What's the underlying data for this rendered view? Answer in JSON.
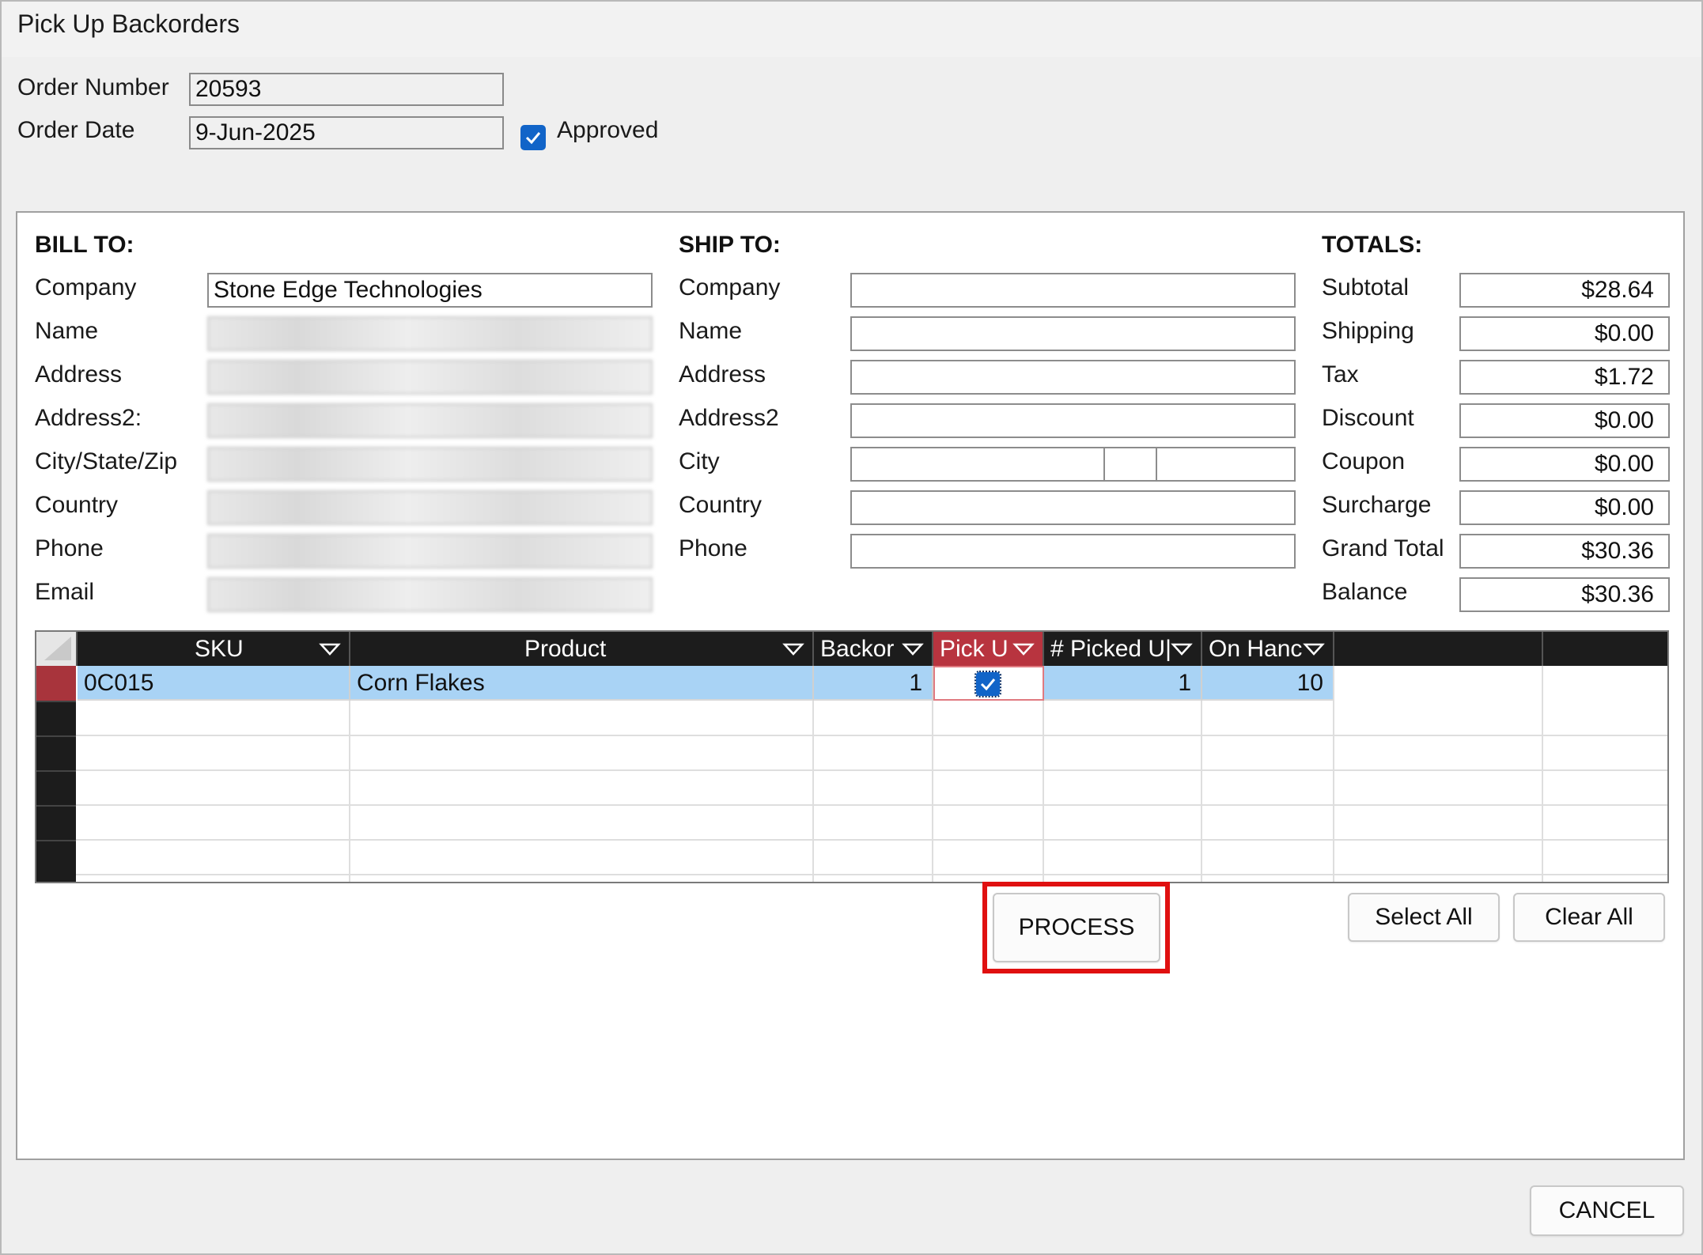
{
  "window": {
    "title": "Pick Up Backorders"
  },
  "order": {
    "number_label": "Order Number",
    "number_value": "20593",
    "date_label": "Order Date",
    "date_value": "9-Jun-2025",
    "approved_label": "Approved",
    "approved_checked": true
  },
  "bill_to": {
    "header": "BILL TO:",
    "company_label": "Company",
    "company_value": "Stone Edge Technologies",
    "name_label": "Name",
    "address_label": "Address",
    "address2_label": "Address2:",
    "city_label": "City/State/Zip",
    "country_label": "Country",
    "phone_label": "Phone",
    "email_label": "Email"
  },
  "ship_to": {
    "header": "SHIP TO:",
    "company_label": "Company",
    "name_label": "Name",
    "address_label": "Address",
    "address2_label": "Address2",
    "city_label": "City",
    "country_label": "Country",
    "phone_label": "Phone"
  },
  "totals": {
    "header": "TOTALS:",
    "subtotal_label": "Subtotal",
    "subtotal": "$28.64",
    "shipping_label": "Shipping",
    "shipping": "$0.00",
    "tax_label": "Tax",
    "tax": "$1.72",
    "discount_label": "Discount",
    "discount": "$0.00",
    "coupon_label": "Coupon",
    "coupon": "$0.00",
    "surcharge_label": "Surcharge",
    "surcharge": "$0.00",
    "grand_total_label": "Grand Total",
    "grand_total": "$30.36",
    "balance_label": "Balance",
    "balance": "$30.36"
  },
  "grid": {
    "columns": [
      "SKU",
      "Product",
      "Backor",
      "Pick U",
      "# Picked U|",
      "On Hanc"
    ],
    "rows": [
      {
        "sku": "0C015",
        "product": "Corn Flakes",
        "backorder": "1",
        "pick_up": true,
        "picked_up": "1",
        "on_hand": "10"
      }
    ]
  },
  "buttons": {
    "process": "PROCESS",
    "select_all": "Select All",
    "clear_all": "Clear All",
    "cancel": "CANCEL"
  },
  "colors": {
    "highlight": "#e01010",
    "selected_row": "#a9d3f5",
    "active_header": "#b8343f",
    "checkbox": "#1164c8"
  }
}
